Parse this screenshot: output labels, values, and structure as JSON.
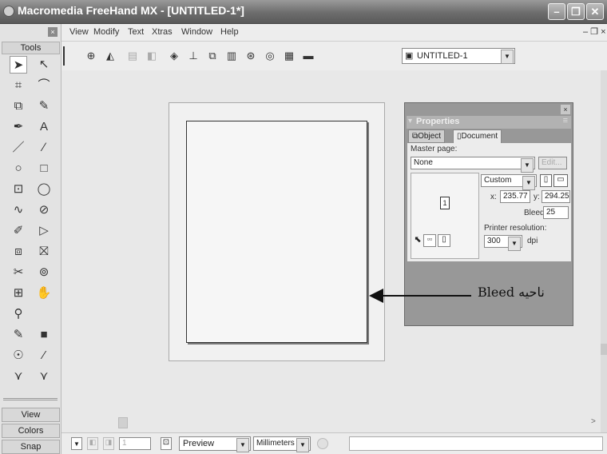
{
  "window": {
    "title": "Macromedia FreeHand MX - [UNTITLED-1*]",
    "minimize_glyph": "–",
    "restore_glyph": "❐",
    "close_glyph": "✕"
  },
  "menu": {
    "items": [
      "View",
      "Modify",
      "Text",
      "Xtras",
      "Window",
      "Help"
    ]
  },
  "tools": {
    "header": "Tools",
    "icons": [
      "➤",
      "↖",
      "⌗",
      "⌒",
      "⧉",
      "✎",
      "✒",
      "A",
      "／",
      "∕",
      "○",
      "□",
      "⊡",
      "◯",
      "∿",
      "⊘",
      "✐",
      "▷",
      "⧈",
      "⛝",
      "✂",
      "⊚",
      "⊞",
      "✋",
      "⚲",
      "",
      "✎",
      "■",
      "☉",
      "⁄",
      "⋎",
      "⋎"
    ],
    "panel_tabs": [
      "View",
      "Colors",
      "Snap"
    ]
  },
  "toolbar": {
    "document_select": "UNTITLED-1"
  },
  "properties": {
    "title": "Properties",
    "tabs": [
      "Object",
      "Document"
    ],
    "master_page_label": "Master page:",
    "master_page_value": "None",
    "edit_label": "Edit...",
    "page_size": "Custom",
    "x_label": "x:",
    "x_value": "235.77",
    "y_label": "y:",
    "y_value": "294.25",
    "bleed_label": "Bleed:",
    "bleed_value": "25",
    "printer_resolution_label": "Printer resolution:",
    "resolution_value": "300",
    "resolution_unit": "dpi",
    "page_number": "1"
  },
  "annotation": {
    "text": "ناحیه Bleed"
  },
  "status": {
    "page_field": "1",
    "view_mode": "Preview",
    "units": "Millimeters"
  }
}
